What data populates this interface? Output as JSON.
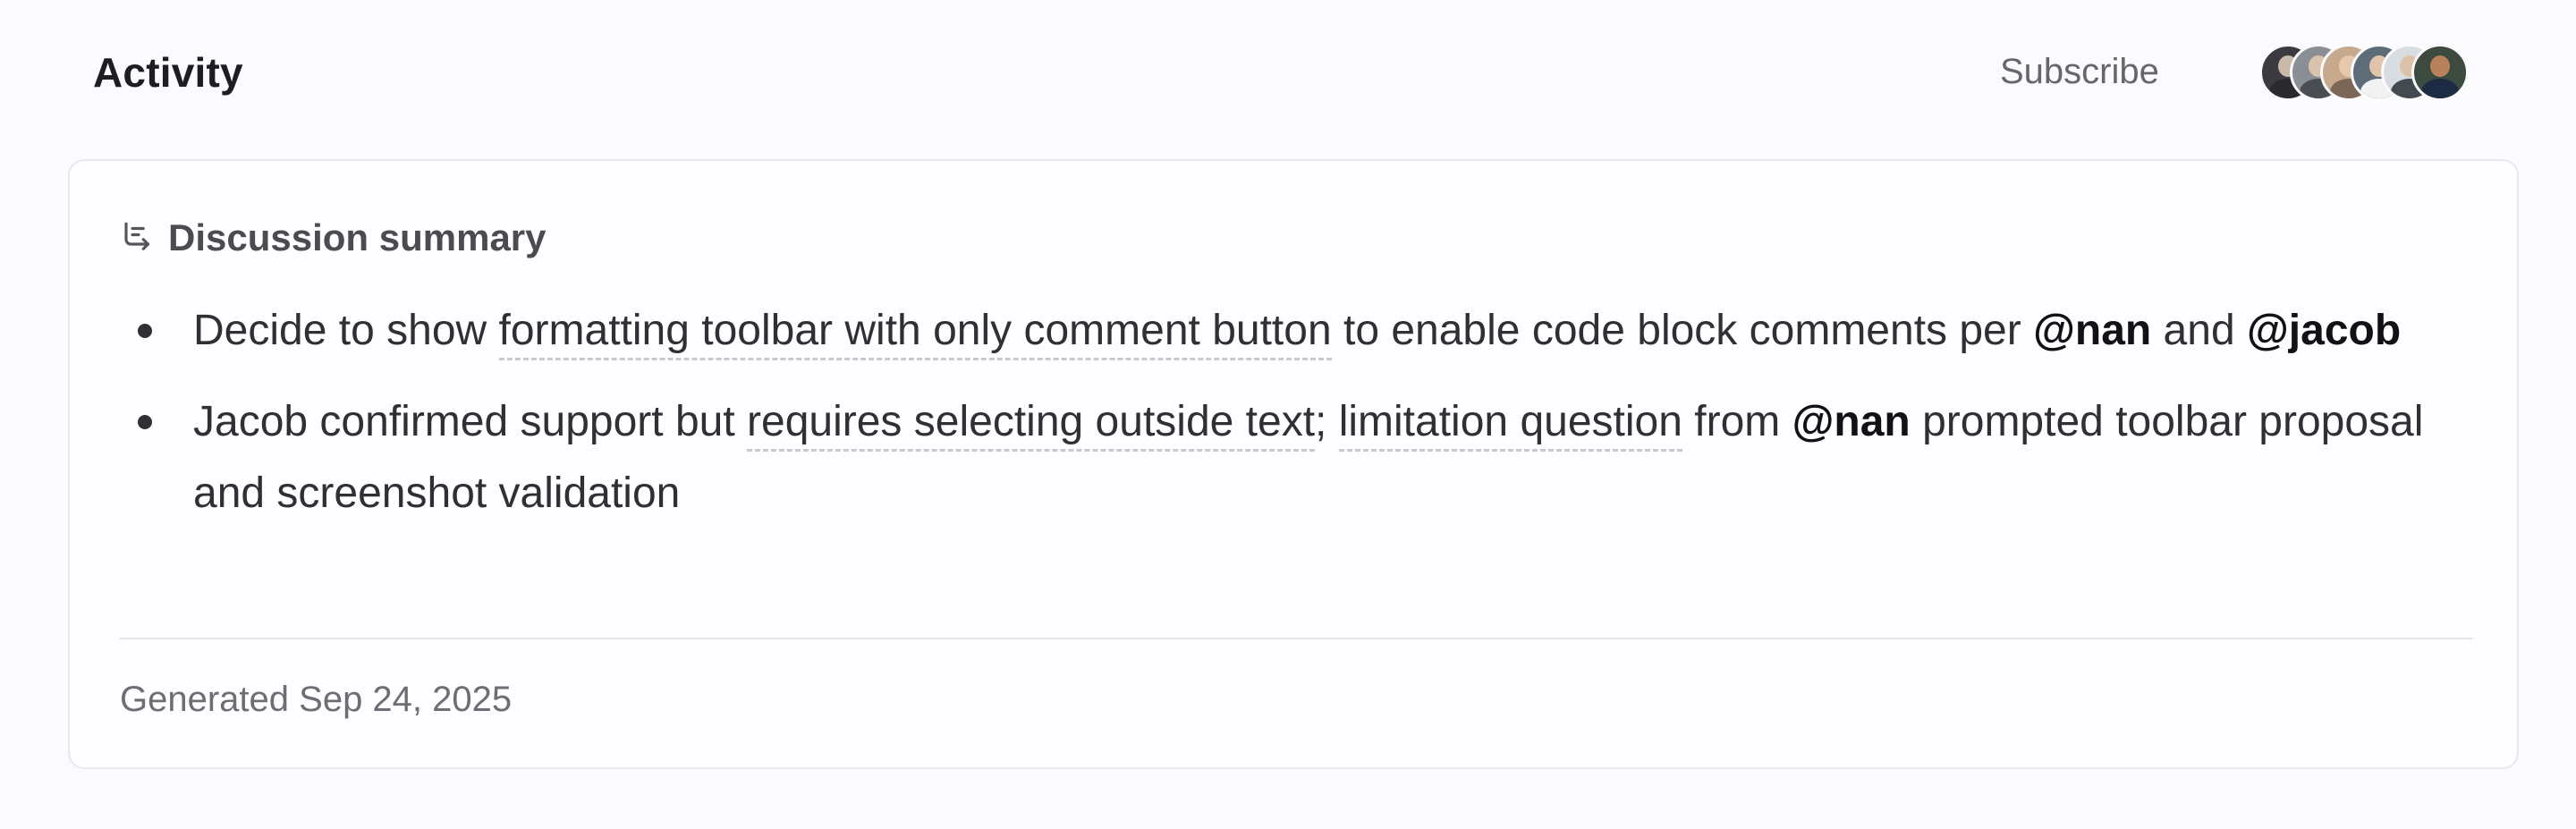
{
  "header": {
    "title": "Activity",
    "subscribe_label": "Subscribe",
    "avatars": [
      {
        "name": "avatar-1",
        "bg": "#3a3a40",
        "skin": "#c9b9a8",
        "shirt": "#2a2a2e"
      },
      {
        "name": "avatar-2",
        "bg": "#8a8f96",
        "skin": "#d9c3ac",
        "shirt": "#4a4d52"
      },
      {
        "name": "avatar-3",
        "bg": "#c7a98e",
        "skin": "#e6c9ad",
        "shirt": "#7b6657"
      },
      {
        "name": "avatar-4",
        "bg": "#5e6c78",
        "skin": "#e1c5ab",
        "shirt": "#f2f2f2"
      },
      {
        "name": "avatar-5",
        "bg": "#d8dde2",
        "skin": "#dcc2a8",
        "shirt": "#444a52"
      },
      {
        "name": "avatar-6",
        "bg": "#3c4a3f",
        "skin": "#b8825c",
        "shirt": "#1d2a44"
      }
    ]
  },
  "summary": {
    "icon": "summary-list-icon",
    "title": "Discussion summary",
    "bullets": [
      {
        "segments": [
          {
            "text": "Decide to show ",
            "style": "plain"
          },
          {
            "text": "formatting toolbar with only comment button",
            "style": "highlight"
          },
          {
            "text": " to enable code block comments per ",
            "style": "plain"
          },
          {
            "text": "@nan",
            "style": "mention"
          },
          {
            "text": " and ",
            "style": "plain"
          },
          {
            "text": "@jacob",
            "style": "mention"
          }
        ]
      },
      {
        "segments": [
          {
            "text": "Jacob confirmed support but ",
            "style": "plain"
          },
          {
            "text": "requires selecting outside text",
            "style": "highlight"
          },
          {
            "text": "; ",
            "style": "plain"
          },
          {
            "text": "limitation question",
            "style": "highlight"
          },
          {
            "text": " from ",
            "style": "plain"
          },
          {
            "text": "@nan",
            "style": "mention"
          },
          {
            "text": " prompted toolbar proposal and screenshot validation",
            "style": "plain"
          }
        ]
      }
    ],
    "generated": "Generated Sep 24, 2025"
  },
  "colors": {
    "background": "#fbfafd",
    "card_border": "#e9e8ee",
    "text": "#2f2f35",
    "muted": "#6d6d75",
    "mention": "#121216"
  }
}
